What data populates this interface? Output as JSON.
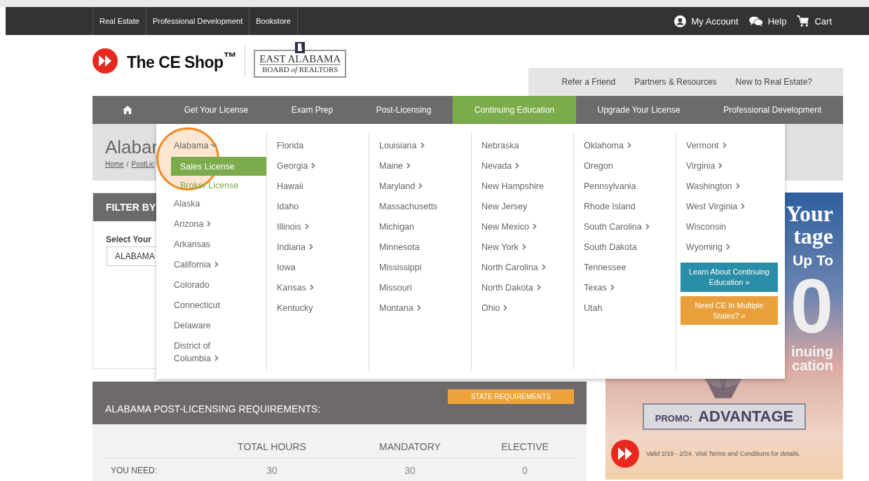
{
  "top_bar": {
    "links": [
      "Real Estate",
      "Professional Development",
      "Bookstore"
    ],
    "account": "My Account",
    "help": "Help",
    "cart": "Cart"
  },
  "header": {
    "logo_text": "The CE Shop$^{™}$",
    "partner_line1": "EAST ALABAMA",
    "partner_line2": "BOARD *of* REALTORS",
    "links": [
      "Refer a Friend",
      "Partners & Resources",
      "New to Real Estate?"
    ]
  },
  "nav": {
    "items": [
      {
        "kind": "home",
        "selected": false
      },
      {
        "kind": "link",
        "label": "Get Your License",
        "selected": false
      },
      {
        "kind": "link",
        "label": "Exam Prep",
        "selected": false
      },
      {
        "kind": "link",
        "label": "Post-Licensing",
        "selected": false
      },
      {
        "kind": "link",
        "label": "Continuing Education",
        "selected": true
      },
      {
        "kind": "link",
        "label": "Upgrade Your License",
        "selected": false
      },
      {
        "kind": "link",
        "label": "Professional Development",
        "selected": false
      }
    ]
  },
  "page": {
    "title": "Alabar",
    "breadcrumb": [
      "Home",
      "PostLic"
    ],
    "separator": "/"
  },
  "filter": {
    "title": "FILTER BY",
    "label": "Select Your",
    "value": "ALABAMA"
  },
  "dropdown": {
    "columns": [
      [
        {
          "label": "Alabama",
          "submenu": true,
          "children": [
            {
              "label": "Sales License",
              "selected": true
            },
            {
              "label": "Broker License",
              "selected": false
            }
          ]
        },
        {
          "label": "Alaska",
          "submenu": false
        },
        {
          "label": "Arizona",
          "submenu": true
        },
        {
          "label": "Arkansas",
          "submenu": false
        },
        {
          "label": "California",
          "submenu": true
        },
        {
          "label": "Colorado",
          "submenu": false
        },
        {
          "label": "Connecticut",
          "submenu": false
        },
        {
          "label": "Delaware",
          "submenu": false
        },
        {
          "label": "District of Columbia",
          "submenu": true
        }
      ],
      [
        {
          "label": "Florida",
          "submenu": false
        },
        {
          "label": "Georgia",
          "submenu": true
        },
        {
          "label": "Hawaii",
          "submenu": false
        },
        {
          "label": "Idaho",
          "submenu": false
        },
        {
          "label": "Illinois",
          "submenu": true
        },
        {
          "label": "Indiana",
          "submenu": true
        },
        {
          "label": "Iowa",
          "submenu": false
        },
        {
          "label": "Kansas",
          "submenu": true
        },
        {
          "label": "Kentucky",
          "submenu": false
        }
      ],
      [
        {
          "label": "Louisiana",
          "submenu": true
        },
        {
          "label": "Maine",
          "submenu": true
        },
        {
          "label": "Maryland",
          "submenu": true
        },
        {
          "label": "Massachusetts",
          "submenu": false
        },
        {
          "label": "Michigan",
          "submenu": false
        },
        {
          "label": "Minnesota",
          "submenu": false
        },
        {
          "label": "Mississippi",
          "submenu": false
        },
        {
          "label": "Missouri",
          "submenu": false
        },
        {
          "label": "Montana",
          "submenu": true
        }
      ],
      [
        {
          "label": "Nebraska",
          "submenu": false
        },
        {
          "label": "Nevada",
          "submenu": true
        },
        {
          "label": "New Hampshire",
          "submenu": false
        },
        {
          "label": "New Jersey",
          "submenu": false
        },
        {
          "label": "New Mexico",
          "submenu": true
        },
        {
          "label": "New York",
          "submenu": true
        },
        {
          "label": "North Carolina",
          "submenu": true
        },
        {
          "label": "North Dakota",
          "submenu": true
        },
        {
          "label": "Ohio",
          "submenu": true
        }
      ],
      [
        {
          "label": "Oklahoma",
          "submenu": true
        },
        {
          "label": "Oregon",
          "submenu": false
        },
        {
          "label": "Pennsylvania",
          "submenu": false
        },
        {
          "label": "Rhode Island",
          "submenu": false
        },
        {
          "label": "South Carolina",
          "submenu": true
        },
        {
          "label": "South Dakota",
          "submenu": false
        },
        {
          "label": "Tennessee",
          "submenu": false
        },
        {
          "label": "Texas",
          "submenu": true
        },
        {
          "label": "Utah",
          "submenu": false
        }
      ],
      [
        {
          "label": "Vermont",
          "submenu": true
        },
        {
          "label": "Virginia",
          "submenu": true
        },
        {
          "label": "Washington",
          "submenu": true
        },
        {
          "label": "West Virginia",
          "submenu": true
        },
        {
          "label": "Wisconsin",
          "submenu": false
        },
        {
          "label": "Wyoming",
          "submenu": true
        }
      ]
    ],
    "buttons": [
      {
        "label": "Learn About Continuing Education »",
        "color": "#2a8ea8"
      },
      {
        "label": "Need CE In Multiple States? »",
        "color": "#e9a03b"
      }
    ]
  },
  "requirements": {
    "title": "ALABAMA POST-LICENSING REQUIREMENTS:",
    "button": "STATE REQUIREMENTS",
    "columns": [
      "TOTAL HOURS",
      "MANDATORY",
      "ELECTIVE"
    ],
    "rows": [
      {
        "label": "YOU NEED:",
        "values": [
          "30",
          "30",
          "0"
        ]
      }
    ]
  },
  "promo": {
    "headline": [
      {
        "text": "Your",
        "kind": "serif"
      },
      {
        "text": "tage",
        "kind": "serif"
      },
      {
        "text": "Up To",
        "kind": "sans"
      },
      {
        "text": "0",
        "kind": "numeral"
      },
      {
        "text": "inuing",
        "kind": "small"
      },
      {
        "text": "cation",
        "kind": "small"
      }
    ],
    "code_label": "PROMO:",
    "code": "ADVANTAGE",
    "note": "Valid 2/19 - 2/24. Visit Terms and Conditions for details."
  }
}
